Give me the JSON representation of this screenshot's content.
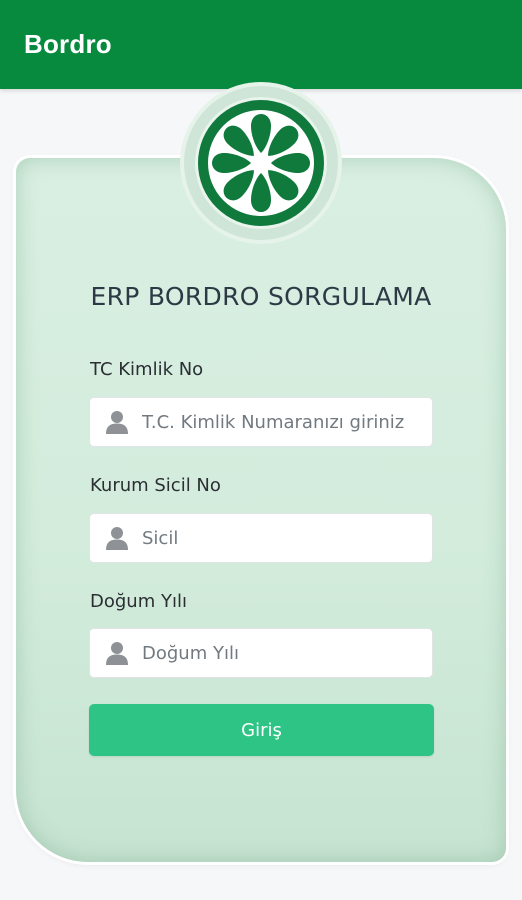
{
  "appbar": {
    "title": "Bordro"
  },
  "colors": {
    "primary": "#078a3d",
    "card": "#d3ecdc",
    "button": "#2ec486",
    "logo": "#107a3d"
  },
  "logo": {
    "icon": "flower-logo-icon"
  },
  "form": {
    "heading": "ERP BORDRO SORGULAMA",
    "fields": [
      {
        "label": "TC Kimlik No",
        "placeholder": "T.C. Kimlik Numaranızı giriniz",
        "value": "",
        "icon": "person-icon"
      },
      {
        "label": "Kurum Sicil No",
        "placeholder": "Sicil",
        "value": "",
        "icon": "person-icon"
      },
      {
        "label": "Doğum Yılı",
        "placeholder": "Doğum Yılı",
        "value": "",
        "icon": "person-icon"
      }
    ],
    "submit_label": "Giriş"
  }
}
